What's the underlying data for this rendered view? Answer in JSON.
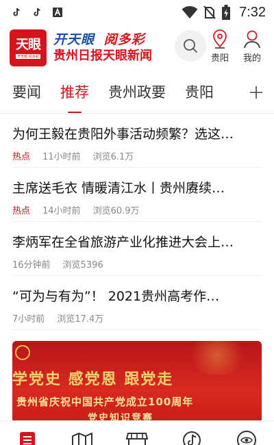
{
  "status_bar": {
    "time": "7:32",
    "left_icons": [
      "tiktok-icon",
      "tiktok-icon",
      "font-icon"
    ],
    "right_icons": [
      "wifi-icon",
      "no-sim-icon",
      "battery-icon"
    ]
  },
  "header": {
    "logo_text": "天眼",
    "logo_sub": "开天眼 阅多彩",
    "brand_line1_a": "开天眼",
    "brand_line1_b": "阅多彩",
    "brand_line2": "贵州日报天眼新闻",
    "location_label": "贵阳",
    "me_label": "我的"
  },
  "tabs": {
    "items": [
      "要闻",
      "推荐",
      "贵州政要",
      "贵阳"
    ],
    "active_index": 1,
    "more_icon": "plus-icon"
  },
  "news": [
    {
      "title": "为何王毅在贵阳外事活动频繁？选这…",
      "tag": "热点",
      "time": "11小时前",
      "views": "浏览6.1万"
    },
    {
      "title": "主席送毛衣  情暖清江水丨贵州赓续…",
      "tag": "热点",
      "time": "14小时前",
      "views": "浏览60.9万"
    },
    {
      "title": "李炳军在全省旅游产业化推进大会上…",
      "tag": "",
      "time": "16分钟前",
      "views": "浏览5396"
    },
    {
      "title": "“可为与有为”！ 2021贵州高考作…",
      "tag": "",
      "time": "7小时前",
      "views": "浏览17.4万"
    }
  ],
  "banner": {
    "line1": "学党史  感党恩  跟党走",
    "line2": "贵州省庆祝中国共产党成立100周年",
    "line3": "党史知识竞赛"
  },
  "bottom_nav": {
    "icons": [
      "news-icon",
      "map-icon",
      "shop-icon",
      "music-icon",
      "tianyan-icon"
    ]
  },
  "colors": {
    "accent": "#c8161d",
    "brand_blue": "#1b4fa6",
    "text_muted": "#888888"
  }
}
